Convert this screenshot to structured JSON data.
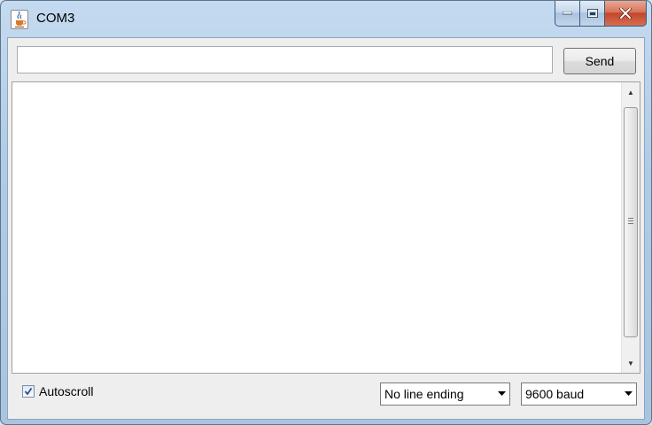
{
  "window": {
    "title": "COM3",
    "icon": "java-cup-icon",
    "controls": [
      "minimize-icon",
      "maximize-icon",
      "close-icon"
    ]
  },
  "input": {
    "value": "",
    "placeholder": ""
  },
  "send_button": {
    "label": "Send"
  },
  "output": {
    "text": ""
  },
  "autoscroll": {
    "label": "Autoscroll",
    "checked": true
  },
  "line_ending": {
    "selected": "No line ending"
  },
  "baud_rate": {
    "selected": "9600 baud"
  },
  "colors": {
    "frame": "#b0cbe6",
    "close_button": "#c2472b",
    "client_background": "#eeeeee"
  }
}
